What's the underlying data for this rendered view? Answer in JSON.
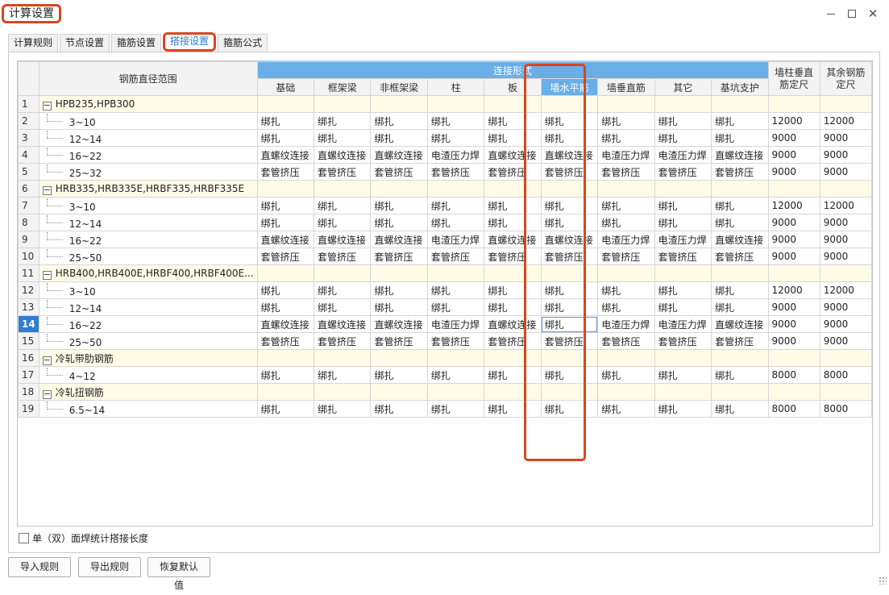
{
  "window": {
    "title": "计算设置"
  },
  "tabs": [
    "计算规则",
    "节点设置",
    "箍筋设置",
    "搭接设置",
    "箍筋公式"
  ],
  "active_tab": 3,
  "table": {
    "col_diameter": "钢筋直径范围",
    "group_header": "连接形式",
    "connect_cols": [
      "基础",
      "框架梁",
      "非框架梁",
      "柱",
      "板",
      "墙水平筋",
      "墙垂直筋",
      "其它",
      "基坑支护"
    ],
    "col_wall_fixed": "墙柱垂直筋定尺",
    "col_other_fixed": "其余钢筋定尺",
    "rows": [
      {
        "num": "1",
        "type": "group",
        "name": "HPB235,HPB300",
        "cells": [
          "",
          "",
          "",
          "",
          "",
          "",
          "",
          "",
          "",
          "",
          ""
        ]
      },
      {
        "num": "2",
        "type": "child",
        "name": "3~10",
        "cells": [
          "绑扎",
          "绑扎",
          "绑扎",
          "绑扎",
          "绑扎",
          "绑扎",
          "绑扎",
          "绑扎",
          "绑扎",
          "12000",
          "12000"
        ]
      },
      {
        "num": "3",
        "type": "child",
        "name": "12~14",
        "cells": [
          "绑扎",
          "绑扎",
          "绑扎",
          "绑扎",
          "绑扎",
          "绑扎",
          "绑扎",
          "绑扎",
          "绑扎",
          "9000",
          "9000"
        ]
      },
      {
        "num": "4",
        "type": "child",
        "name": "16~22",
        "cells": [
          "直螺纹连接",
          "直螺纹连接",
          "直螺纹连接",
          "电渣压力焊",
          "直螺纹连接",
          "直螺纹连接",
          "电渣压力焊",
          "电渣压力焊",
          "直螺纹连接",
          "9000",
          "9000"
        ]
      },
      {
        "num": "5",
        "type": "child",
        "name": "25~32",
        "cells": [
          "套管挤压",
          "套管挤压",
          "套管挤压",
          "套管挤压",
          "套管挤压",
          "套管挤压",
          "套管挤压",
          "套管挤压",
          "套管挤压",
          "9000",
          "9000"
        ]
      },
      {
        "num": "6",
        "type": "group",
        "name": "HRB335,HRB335E,HRBF335,HRBF335E",
        "cells": [
          "",
          "",
          "",
          "",
          "",
          "",
          "",
          "",
          "",
          "",
          ""
        ]
      },
      {
        "num": "7",
        "type": "child",
        "name": "3~10",
        "cells": [
          "绑扎",
          "绑扎",
          "绑扎",
          "绑扎",
          "绑扎",
          "绑扎",
          "绑扎",
          "绑扎",
          "绑扎",
          "12000",
          "12000"
        ]
      },
      {
        "num": "8",
        "type": "child",
        "name": "12~14",
        "cells": [
          "绑扎",
          "绑扎",
          "绑扎",
          "绑扎",
          "绑扎",
          "绑扎",
          "绑扎",
          "绑扎",
          "绑扎",
          "9000",
          "9000"
        ]
      },
      {
        "num": "9",
        "type": "child",
        "name": "16~22",
        "cells": [
          "直螺纹连接",
          "直螺纹连接",
          "直螺纹连接",
          "电渣压力焊",
          "直螺纹连接",
          "直螺纹连接",
          "电渣压力焊",
          "电渣压力焊",
          "直螺纹连接",
          "9000",
          "9000"
        ]
      },
      {
        "num": "10",
        "type": "child",
        "name": "25~50",
        "cells": [
          "套管挤压",
          "套管挤压",
          "套管挤压",
          "套管挤压",
          "套管挤压",
          "套管挤压",
          "套管挤压",
          "套管挤压",
          "套管挤压",
          "9000",
          "9000"
        ]
      },
      {
        "num": "11",
        "type": "group",
        "name": "HRB400,HRB400E,HRBF400,HRBF400E...",
        "cells": [
          "",
          "",
          "",
          "",
          "",
          "",
          "",
          "",
          "",
          "",
          ""
        ]
      },
      {
        "num": "12",
        "type": "child",
        "name": "3~10",
        "cells": [
          "绑扎",
          "绑扎",
          "绑扎",
          "绑扎",
          "绑扎",
          "绑扎",
          "绑扎",
          "绑扎",
          "绑扎",
          "12000",
          "12000"
        ]
      },
      {
        "num": "13",
        "type": "child",
        "name": "12~14",
        "cells": [
          "绑扎",
          "绑扎",
          "绑扎",
          "绑扎",
          "绑扎",
          "绑扎",
          "绑扎",
          "绑扎",
          "绑扎",
          "9000",
          "9000"
        ]
      },
      {
        "num": "14",
        "type": "child",
        "name": "16~22",
        "cells": [
          "直螺纹连接",
          "直螺纹连接",
          "直螺纹连接",
          "电渣压力焊",
          "直螺纹连接",
          "绑扎",
          "电渣压力焊",
          "电渣压力焊",
          "直螺纹连接",
          "9000",
          "9000"
        ],
        "selected": true
      },
      {
        "num": "15",
        "type": "child",
        "name": "25~50",
        "cells": [
          "套管挤压",
          "套管挤压",
          "套管挤压",
          "套管挤压",
          "套管挤压",
          "套管挤压",
          "套管挤压",
          "套管挤压",
          "套管挤压",
          "9000",
          "9000"
        ]
      },
      {
        "num": "16",
        "type": "group",
        "name": "冷轧带肋钢筋",
        "cells": [
          "",
          "",
          "",
          "",
          "",
          "",
          "",
          "",
          "",
          "",
          ""
        ]
      },
      {
        "num": "17",
        "type": "child",
        "name": "4~12",
        "cells": [
          "绑扎",
          "绑扎",
          "绑扎",
          "绑扎",
          "绑扎",
          "绑扎",
          "绑扎",
          "绑扎",
          "绑扎",
          "8000",
          "8000"
        ]
      },
      {
        "num": "18",
        "type": "group",
        "name": "冷轧扭钢筋",
        "cells": [
          "",
          "",
          "",
          "",
          "",
          "",
          "",
          "",
          "",
          "",
          ""
        ]
      },
      {
        "num": "19",
        "type": "child",
        "name": "6.5~14",
        "cells": [
          "绑扎",
          "绑扎",
          "绑扎",
          "绑扎",
          "绑扎",
          "绑扎",
          "绑扎",
          "绑扎",
          "绑扎",
          "8000",
          "8000"
        ]
      }
    ]
  },
  "checkbox_label": "单（双）面焊统计搭接长度",
  "buttons": {
    "import": "导入规则",
    "export": "导出规则",
    "restore": "恢复默认值"
  },
  "colors": {
    "accent": "#2f7cd3",
    "header_blue": "#6aaee7",
    "highlight_red": "#d8471e",
    "group_row": "#fffbe6"
  }
}
